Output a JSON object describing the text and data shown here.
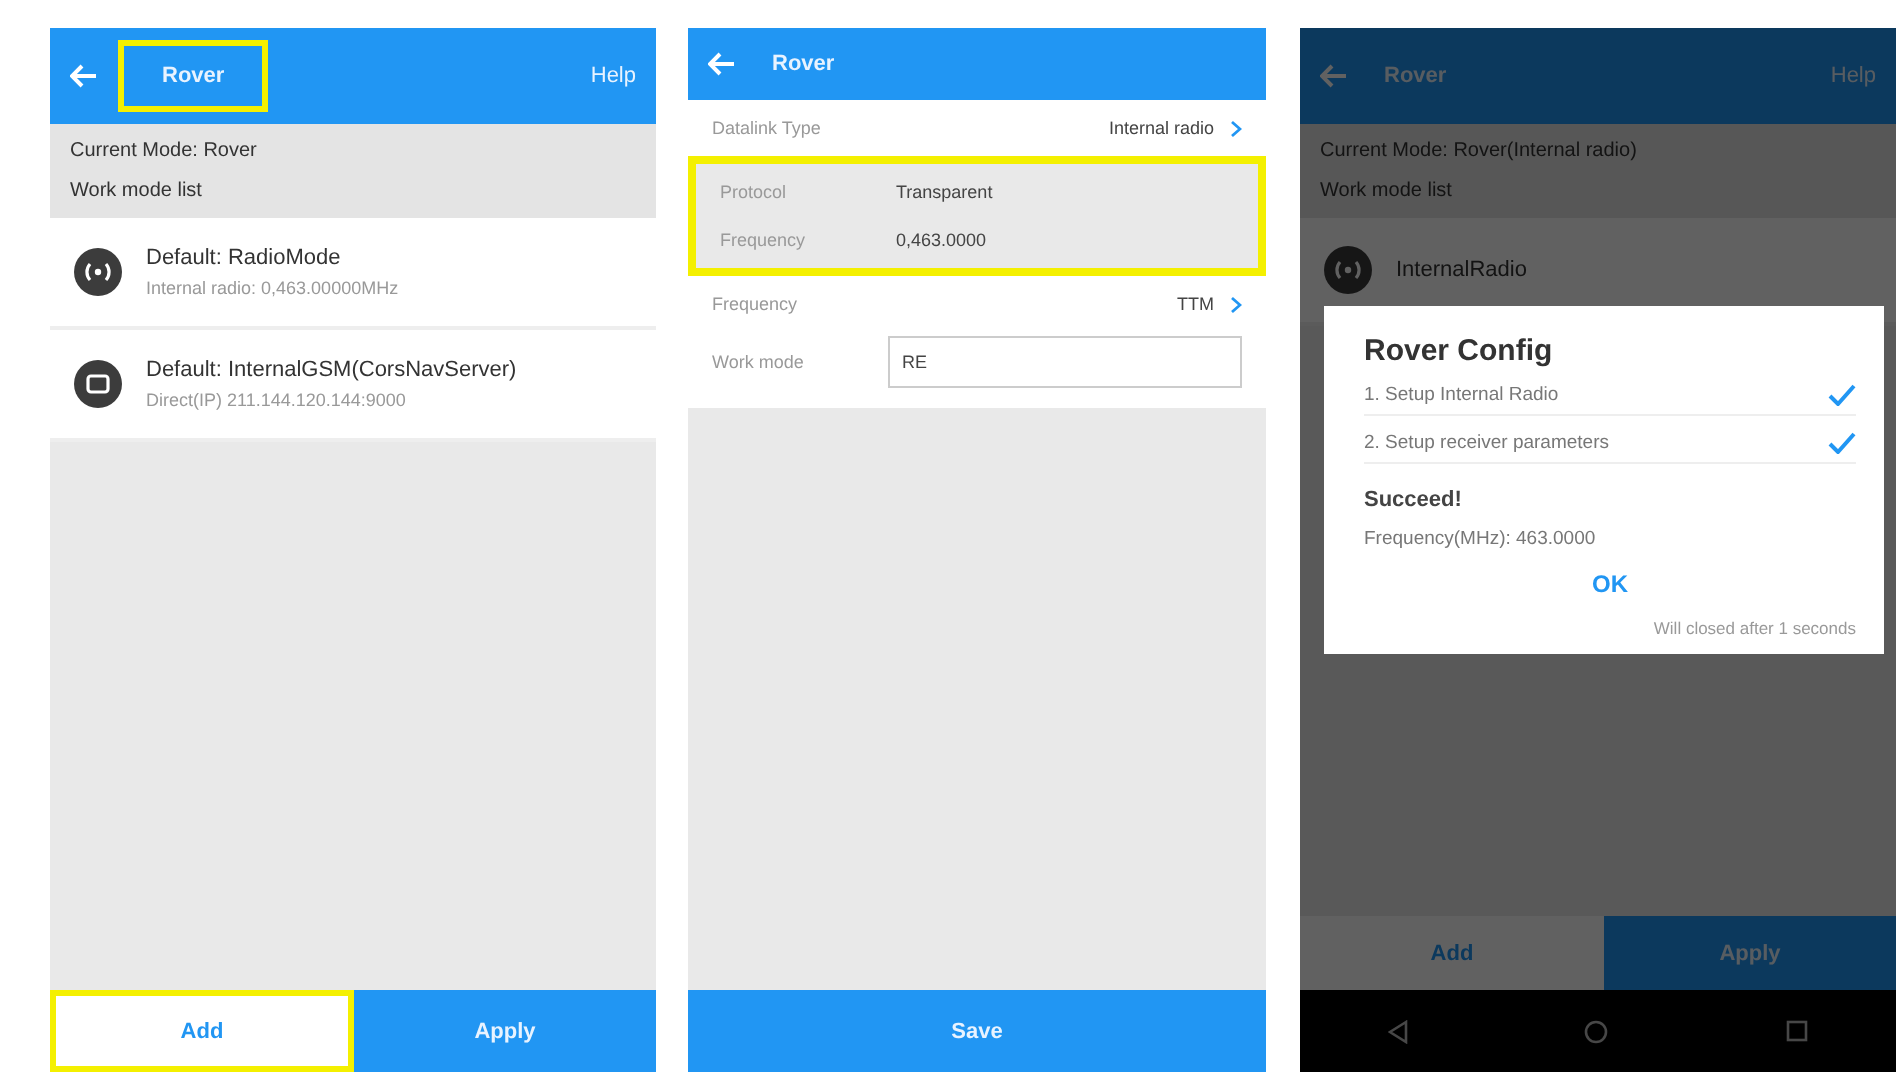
{
  "screens": [
    {
      "kind": "mode_list",
      "header": {
        "title": "Rover",
        "highlighted": true,
        "action": "Help"
      },
      "info": [
        "Current Mode:  Rover",
        "Work mode list"
      ],
      "modes": [
        {
          "kind": "radio",
          "title": "Default: RadioMode",
          "detail": "Internal radio: 0,463.00000MHz"
        },
        {
          "kind": "gsm",
          "title": "Default: InternalGSM(CorsNavServer)",
          "detail": "Direct(IP) 211.144.120.144:9000"
        }
      ],
      "buttons": [
        {
          "kind": "plain",
          "label": "Add",
          "highlighted": true
        },
        {
          "kind": "primary",
          "label": "Apply",
          "highlighted": false
        }
      ]
    },
    {
      "kind": "settings",
      "header": {
        "title": "Rover",
        "highlighted": false
      },
      "rows": [
        {
          "kind": "select",
          "label": "Datalink Type",
          "value": "Internal radio"
        },
        {
          "kind": "info_group",
          "highlighted": true,
          "rows": [
            {
              "label": "Protocol",
              "value": "Transparent"
            },
            {
              "label": "Frequency",
              "value": "0,463.0000"
            }
          ]
        },
        {
          "kind": "select",
          "label": "Frequency",
          "value": "TTM"
        },
        {
          "kind": "input",
          "label": "Work mode",
          "value": "RE"
        }
      ],
      "buttons": [
        {
          "kind": "primary",
          "label": "Save",
          "highlighted": false
        }
      ]
    },
    {
      "kind": "mode_list",
      "dimmed": true,
      "nav_bar": true,
      "header": {
        "title": "Rover",
        "highlighted": false,
        "action": "Help"
      },
      "info": [
        "Current Mode:  Rover(Internal radio)",
        "Work mode list"
      ],
      "modes": [
        {
          "kind": "radio",
          "title": "InternalRadio"
        }
      ],
      "buttons": [
        {
          "kind": "plain",
          "label": "Add",
          "highlighted": false
        },
        {
          "kind": "primary",
          "label": "Apply",
          "highlighted": false
        }
      ],
      "dialog": {
        "title": "Rover Config",
        "steps": [
          {
            "label": "1. Setup Internal Radio",
            "done": true
          },
          {
            "label": "2. Setup receiver parameters",
            "done": true
          }
        ],
        "status": "Succeed!",
        "result": "Frequency(MHz):  463.0000",
        "ok": "OK",
        "note": "Will closed after 1 seconds"
      }
    }
  ]
}
